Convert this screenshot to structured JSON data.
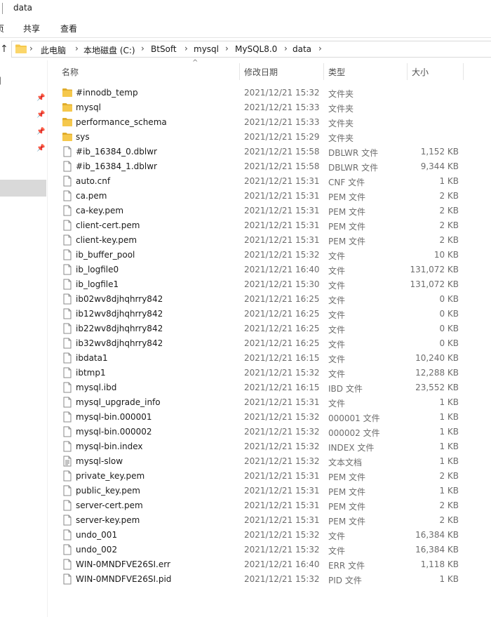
{
  "window": {
    "title": "data",
    "edge_char": "⌐"
  },
  "ribbon": {
    "tabs": [
      "页",
      "共享",
      "查看"
    ]
  },
  "address": {
    "crumbs": [
      "此电脑",
      "本地磁盘 (C:)",
      "BtSoft",
      "mysql",
      "MySQL8.0",
      "data"
    ]
  },
  "nav": {
    "bracket": "]"
  },
  "columns": {
    "name": "名称",
    "date": "修改日期",
    "type": "类型",
    "size": "大小"
  },
  "colors": {
    "folder": "#f5c84c",
    "folder_dark": "#e0ac2a",
    "selection": "#d9d9d9"
  },
  "files": [
    {
      "icon": "folder",
      "name": "#innodb_temp",
      "date": "2021/12/21 15:32",
      "type": "文件夹",
      "size": ""
    },
    {
      "icon": "folder",
      "name": "mysql",
      "date": "2021/12/21 15:33",
      "type": "文件夹",
      "size": ""
    },
    {
      "icon": "folder",
      "name": "performance_schema",
      "date": "2021/12/21 15:33",
      "type": "文件夹",
      "size": ""
    },
    {
      "icon": "folder",
      "name": "sys",
      "date": "2021/12/21 15:29",
      "type": "文件夹",
      "size": ""
    },
    {
      "icon": "file",
      "name": "#ib_16384_0.dblwr",
      "date": "2021/12/21 15:58",
      "type": "DBLWR 文件",
      "size": "1,152 KB"
    },
    {
      "icon": "file",
      "name": "#ib_16384_1.dblwr",
      "date": "2021/12/21 15:58",
      "type": "DBLWR 文件",
      "size": "9,344 KB"
    },
    {
      "icon": "file",
      "name": "auto.cnf",
      "date": "2021/12/21 15:31",
      "type": "CNF 文件",
      "size": "1 KB"
    },
    {
      "icon": "file",
      "name": "ca.pem",
      "date": "2021/12/21 15:31",
      "type": "PEM 文件",
      "size": "2 KB"
    },
    {
      "icon": "file",
      "name": "ca-key.pem",
      "date": "2021/12/21 15:31",
      "type": "PEM 文件",
      "size": "2 KB"
    },
    {
      "icon": "file",
      "name": "client-cert.pem",
      "date": "2021/12/21 15:31",
      "type": "PEM 文件",
      "size": "2 KB"
    },
    {
      "icon": "file",
      "name": "client-key.pem",
      "date": "2021/12/21 15:31",
      "type": "PEM 文件",
      "size": "2 KB"
    },
    {
      "icon": "file",
      "name": "ib_buffer_pool",
      "date": "2021/12/21 15:32",
      "type": "文件",
      "size": "10 KB"
    },
    {
      "icon": "file",
      "name": "ib_logfile0",
      "date": "2021/12/21 16:40",
      "type": "文件",
      "size": "131,072 KB"
    },
    {
      "icon": "file",
      "name": "ib_logfile1",
      "date": "2021/12/21 15:30",
      "type": "文件",
      "size": "131,072 KB"
    },
    {
      "icon": "file",
      "name": "ib02wv8djhqhrry842",
      "date": "2021/12/21 16:25",
      "type": "文件",
      "size": "0 KB"
    },
    {
      "icon": "file",
      "name": "ib12wv8djhqhrry842",
      "date": "2021/12/21 16:25",
      "type": "文件",
      "size": "0 KB"
    },
    {
      "icon": "file",
      "name": "ib22wv8djhqhrry842",
      "date": "2021/12/21 16:25",
      "type": "文件",
      "size": "0 KB"
    },
    {
      "icon": "file",
      "name": "ib32wv8djhqhrry842",
      "date": "2021/12/21 16:25",
      "type": "文件",
      "size": "0 KB"
    },
    {
      "icon": "file",
      "name": "ibdata1",
      "date": "2021/12/21 16:15",
      "type": "文件",
      "size": "10,240 KB"
    },
    {
      "icon": "file",
      "name": "ibtmp1",
      "date": "2021/12/21 15:32",
      "type": "文件",
      "size": "12,288 KB"
    },
    {
      "icon": "file",
      "name": "mysql.ibd",
      "date": "2021/12/21 16:15",
      "type": "IBD 文件",
      "size": "23,552 KB"
    },
    {
      "icon": "file",
      "name": "mysql_upgrade_info",
      "date": "2021/12/21 15:31",
      "type": "文件",
      "size": "1 KB"
    },
    {
      "icon": "file",
      "name": "mysql-bin.000001",
      "date": "2021/12/21 15:32",
      "type": "000001 文件",
      "size": "1 KB"
    },
    {
      "icon": "file",
      "name": "mysql-bin.000002",
      "date": "2021/12/21 15:32",
      "type": "000002 文件",
      "size": "1 KB"
    },
    {
      "icon": "file",
      "name": "mysql-bin.index",
      "date": "2021/12/21 15:32",
      "type": "INDEX 文件",
      "size": "1 KB"
    },
    {
      "icon": "text",
      "name": "mysql-slow",
      "date": "2021/12/21 15:32",
      "type": "文本文档",
      "size": "1 KB"
    },
    {
      "icon": "file",
      "name": "private_key.pem",
      "date": "2021/12/21 15:31",
      "type": "PEM 文件",
      "size": "2 KB"
    },
    {
      "icon": "file",
      "name": "public_key.pem",
      "date": "2021/12/21 15:31",
      "type": "PEM 文件",
      "size": "1 KB"
    },
    {
      "icon": "file",
      "name": "server-cert.pem",
      "date": "2021/12/21 15:31",
      "type": "PEM 文件",
      "size": "2 KB"
    },
    {
      "icon": "file",
      "name": "server-key.pem",
      "date": "2021/12/21 15:31",
      "type": "PEM 文件",
      "size": "2 KB"
    },
    {
      "icon": "file",
      "name": "undo_001",
      "date": "2021/12/21 15:32",
      "type": "文件",
      "size": "16,384 KB"
    },
    {
      "icon": "file",
      "name": "undo_002",
      "date": "2021/12/21 15:32",
      "type": "文件",
      "size": "16,384 KB"
    },
    {
      "icon": "file",
      "name": "WIN-0MNDFVE26SI.err",
      "date": "2021/12/21 16:40",
      "type": "ERR 文件",
      "size": "1,118 KB"
    },
    {
      "icon": "file",
      "name": "WIN-0MNDFVE26SI.pid",
      "date": "2021/12/21 15:32",
      "type": "PID 文件",
      "size": "1 KB"
    }
  ]
}
